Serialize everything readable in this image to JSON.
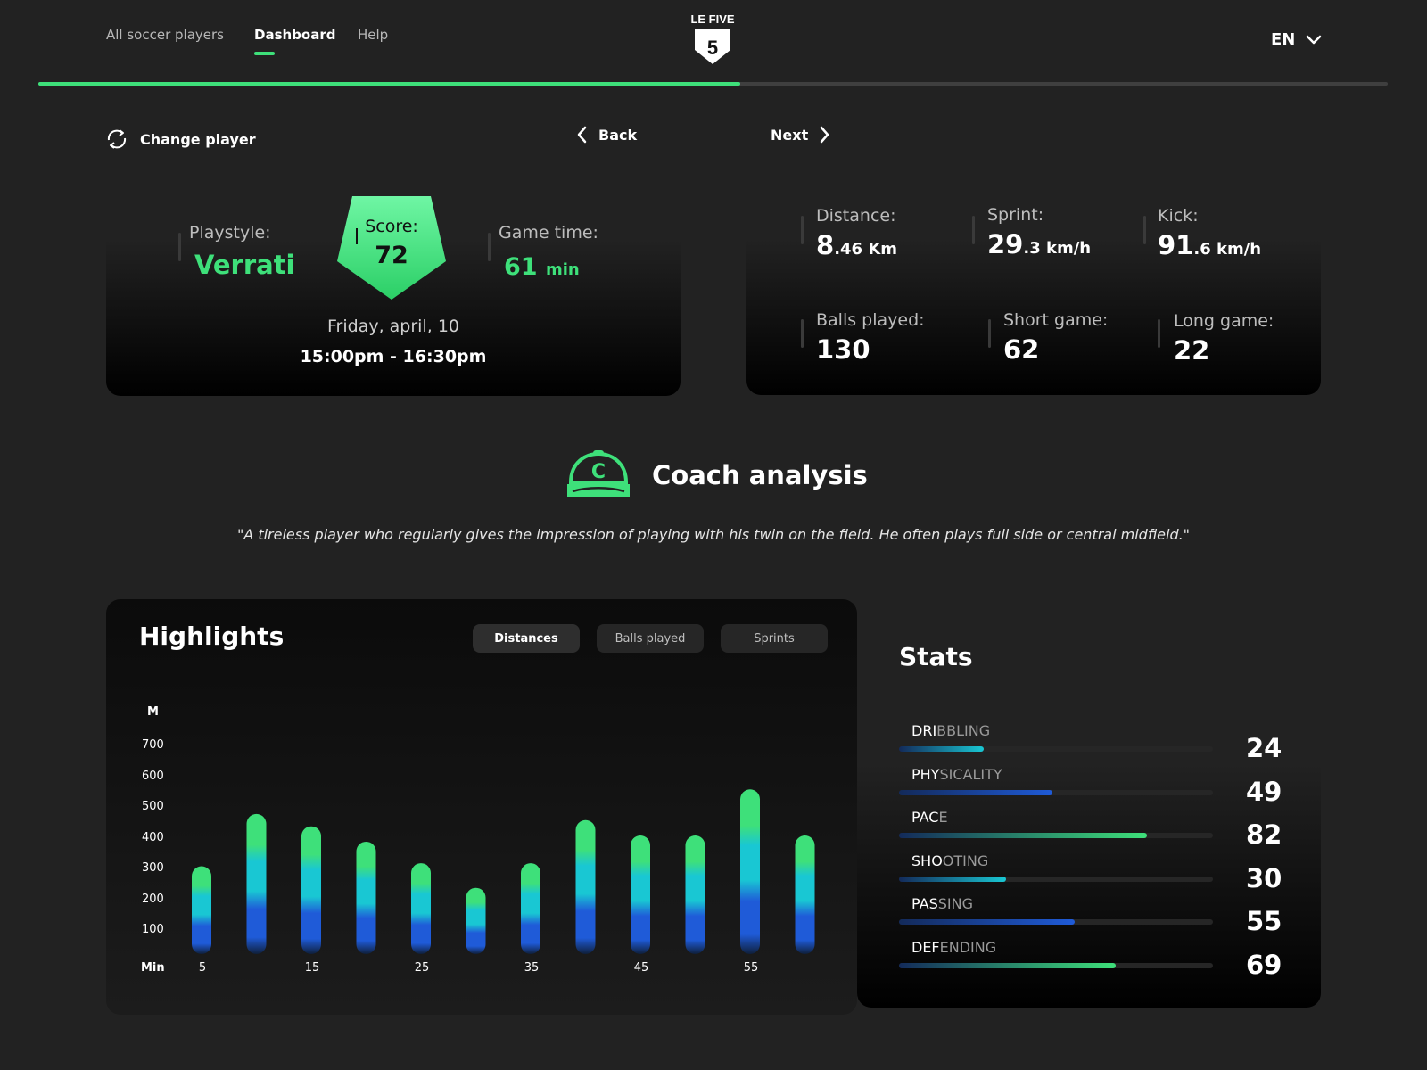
{
  "nav": {
    "items": [
      {
        "label": "All soccer players",
        "active": false
      },
      {
        "label": "Dashboard",
        "active": true
      },
      {
        "label": "Help",
        "active": false
      }
    ],
    "logo_text": "LE FIVE",
    "logo_number": "5",
    "language": "EN",
    "progress": 0.52
  },
  "actions": {
    "change_player": "Change player",
    "back": "Back",
    "next": "Next"
  },
  "match": {
    "playstyle_label": "Playstyle:",
    "playstyle_value": "Verrati",
    "score_label": "Score:",
    "score_value": "72",
    "game_time_label": "Game time:",
    "game_time_value": "61",
    "game_time_unit": "min",
    "date": "Friday, april, 10",
    "time": "15:00pm - 16:30pm"
  },
  "metrics": {
    "distance": {
      "label": "Distance:",
      "value": "8",
      "decimal": ".46 Km"
    },
    "sprint": {
      "label": "Sprint:",
      "value": "29",
      "decimal": ".3 km/h"
    },
    "kick": {
      "label": "Kick:",
      "value": "91",
      "decimal": ".6 km/h"
    },
    "balls_played": {
      "label": "Balls played:",
      "value": "130"
    },
    "short_game": {
      "label": "Short game:",
      "value": "62"
    },
    "long_game": {
      "label": "Long game:",
      "value": "22"
    }
  },
  "coach": {
    "title": "Coach analysis",
    "icon_letter": "C",
    "quote": "\"A tireless player who regularly gives the impression of playing with his twin on the field. He often plays full side or central midfield.\""
  },
  "highlights": {
    "title": "Highlights",
    "tabs": [
      {
        "label": "Distances",
        "active": true
      },
      {
        "label": "Balls played",
        "active": false
      },
      {
        "label": "Sprints",
        "active": false
      }
    ]
  },
  "chart_data": {
    "type": "bar",
    "ylabel": "M",
    "xlabel": "Min",
    "yticks": [
      700,
      600,
      500,
      400,
      300,
      200,
      100
    ],
    "xticks": [
      "5",
      "15",
      "25",
      "35",
      "45",
      "55"
    ],
    "ylim": [
      0,
      760
    ],
    "x": [
      5,
      10,
      15,
      20,
      25,
      30,
      35,
      40,
      45,
      50,
      55,
      60
    ],
    "values": [
      310,
      480,
      440,
      390,
      320,
      240,
      320,
      460,
      410,
      410,
      560,
      410
    ],
    "colors": {
      "top": "#3ee07a",
      "mid": "#19c7d3",
      "low": "#1f5bd8"
    }
  },
  "stats": {
    "title": "Stats",
    "items": [
      {
        "hi": "DRI",
        "rest": "BBLING",
        "value": "24",
        "pct": 0.27,
        "color": "#19c7d3"
      },
      {
        "hi": "PHY",
        "rest": "SICALITY",
        "value": "49",
        "pct": 0.49,
        "color": "#1f5bd8"
      },
      {
        "hi": "PAC",
        "rest": "E",
        "value": "82",
        "pct": 0.79,
        "color": "#3ee07a"
      },
      {
        "hi": "SHO",
        "rest": "OTING",
        "value": "30",
        "pct": 0.34,
        "color": "#19c7d3"
      },
      {
        "hi": "PAS",
        "rest": "SING",
        "value": "55",
        "pct": 0.56,
        "color": "#1f5bd8"
      },
      {
        "hi": "DEF",
        "rest": "ENDING",
        "value": "69",
        "pct": 0.69,
        "color": "#3ee07a"
      }
    ]
  }
}
